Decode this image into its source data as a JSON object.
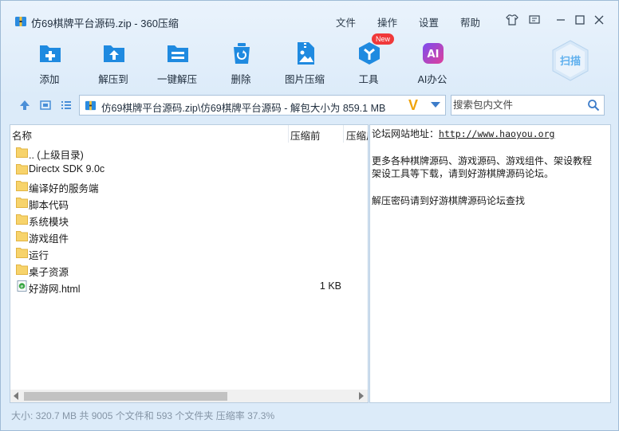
{
  "window": {
    "title": "仿69棋牌平台源码.zip - 360压缩",
    "menu": [
      "文件",
      "操作",
      "设置",
      "帮助"
    ]
  },
  "toolbar": {
    "items": [
      {
        "label": "添加",
        "icon": "add-icon"
      },
      {
        "label": "解压到",
        "icon": "extract-to-icon"
      },
      {
        "label": "一键解压",
        "icon": "one-click-extract-icon"
      },
      {
        "label": "删除",
        "icon": "trash-icon"
      },
      {
        "label": "图片压缩",
        "icon": "image-compress-icon"
      },
      {
        "label": "工具",
        "icon": "tools-icon"
      },
      {
        "label": "AI办公",
        "icon": "ai-office-icon"
      }
    ],
    "new_badge": "New",
    "scan_label": "扫描",
    "ai_text": "AI"
  },
  "address": {
    "path": "仿69棋牌平台源码.zip\\仿69棋牌平台源码 - 解包大小为 859.1 MB",
    "v_mark": "V"
  },
  "search": {
    "placeholder": "搜索包内文件"
  },
  "list": {
    "columns": [
      "名称",
      "压缩前",
      "压缩后"
    ],
    "rows": [
      {
        "name": ".. (上级目录)",
        "size": "",
        "type": "folder"
      },
      {
        "name": "Directx SDK 9.0c",
        "size": "",
        "type": "folder"
      },
      {
        "name": "编译好的服务端",
        "size": "",
        "type": "folder"
      },
      {
        "name": "脚本代码",
        "size": "",
        "type": "folder"
      },
      {
        "name": "系统模块",
        "size": "",
        "type": "folder"
      },
      {
        "name": "游戏组件",
        "size": "",
        "type": "folder"
      },
      {
        "name": "运行",
        "size": "",
        "type": "folder"
      },
      {
        "name": "桌子资源",
        "size": "",
        "type": "folder"
      },
      {
        "name": "好游网.html",
        "size": "1 KB",
        "type": "html"
      }
    ]
  },
  "comment": {
    "line1_label": "论坛网站地址：",
    "line1_link": "http://www.haoyou.org",
    "line2": "更多各种棋牌源码、游戏源码、游戏组件、架设教程",
    "line3": "架设工具等下载，请到好游棋牌源码论坛。",
    "line4": "解压密码请到好游棋牌源码论坛查找"
  },
  "status": "大小: 320.7 MB 共 9005 个文件和 593 个文件夹 压缩率 37.3%",
  "colors": {
    "accent_blue": "#1f8ae0",
    "orange_v": "#f0a30a",
    "badge_red": "#f0393a"
  }
}
